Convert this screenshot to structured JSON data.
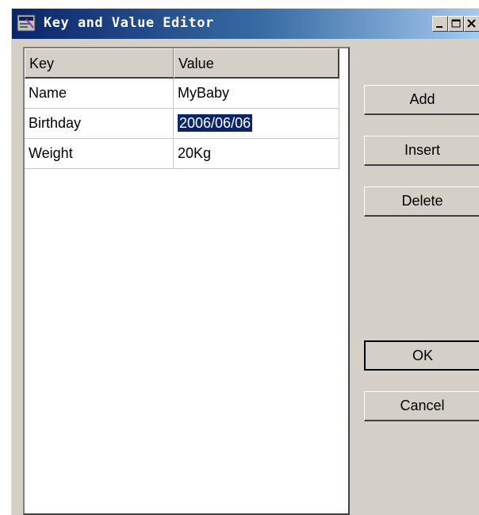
{
  "window": {
    "title": "Key and Value Editor",
    "icon": "app-window-icon"
  },
  "titlebar_buttons": {
    "minimize": "minimize-icon",
    "maximize": "maximize-icon",
    "close": "close-icon"
  },
  "table": {
    "headers": [
      "Key",
      "Value"
    ],
    "rows": [
      {
        "key": "Name",
        "value": "MyBaby"
      },
      {
        "key": "Birthday",
        "value": "2006/06/06",
        "selected": true
      },
      {
        "key": "Weight",
        "value": "20Kg"
      }
    ]
  },
  "buttons": {
    "add": "Add",
    "insert": "Insert",
    "delete": "Delete",
    "ok": "OK",
    "cancel": "Cancel"
  },
  "colors": {
    "title_gradient_start": "#0a246a",
    "title_gradient_end": "#a6caf0",
    "window_face": "#d4d0c8",
    "selection": "#0a246a"
  }
}
